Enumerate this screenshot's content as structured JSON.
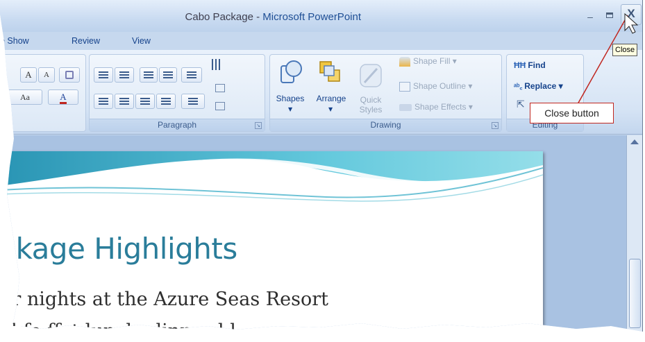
{
  "window": {
    "doc_title": "Cabo Package",
    "title_separator": " - ",
    "app_title": "Microsoft PowerPoint",
    "minimize_glyph": "–",
    "close_glyph": "X"
  },
  "tabs": [
    {
      "label": "e Show"
    },
    {
      "label": "Review"
    },
    {
      "label": "View"
    }
  ],
  "ribbon": {
    "font_group": {
      "grow_font": "A",
      "shrink_font": "A",
      "change_case": "Aa",
      "font_color": "A"
    },
    "paragraph_group": {
      "label": "Paragraph"
    },
    "drawing_group": {
      "label": "Drawing",
      "shapes": "Shapes",
      "arrange": "Arrange",
      "quick_styles_1": "Quick",
      "quick_styles_2": "Styles",
      "shape_fill": "Shape Fill",
      "shape_outline": "Shape Outline",
      "shape_effects": "Shape Effects"
    },
    "editing_group": {
      "label": "Editing",
      "find": "Find",
      "replace": "Replace"
    }
  },
  "slide": {
    "title": "ckage Highlights",
    "line1": "ur nights at the Azure Seas Resort",
    "line2": "al fo     ffet lunch, dinner      l     l"
  },
  "callouts": {
    "tooltip": "Close",
    "close_button": "Close button"
  },
  "colors": {
    "accent": "#15428b",
    "title_teal": "#2a7d9a",
    "callout_red": "#c0261f"
  }
}
